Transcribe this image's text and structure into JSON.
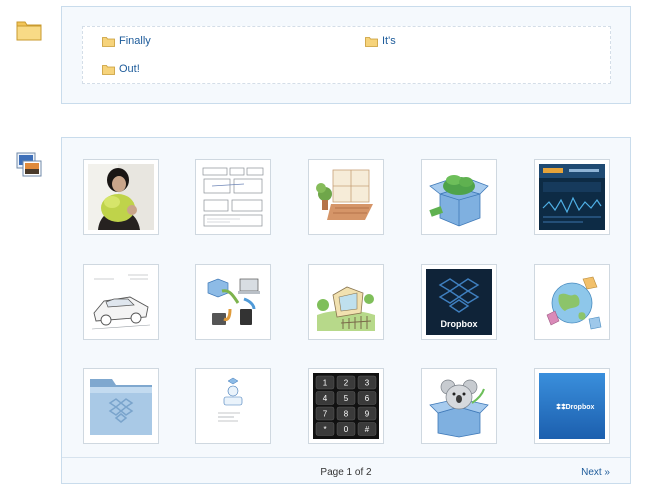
{
  "folders": {
    "items": [
      {
        "label": "Finally"
      },
      {
        "label": "It's"
      },
      {
        "label": "Out!"
      }
    ]
  },
  "photos": {
    "thumbnails": [
      {
        "name": "photo-person-green-toy",
        "icon": "photo-icon"
      },
      {
        "name": "photo-interface-sketch",
        "icon": "photo-icon"
      },
      {
        "name": "photo-window-plants",
        "icon": "photo-icon"
      },
      {
        "name": "photo-box-money",
        "icon": "photo-icon"
      },
      {
        "name": "photo-dark-website",
        "icon": "photo-icon"
      },
      {
        "name": "photo-car-sketch",
        "icon": "photo-icon"
      },
      {
        "name": "photo-boxes-devices",
        "icon": "photo-icon"
      },
      {
        "name": "photo-garden-fence",
        "icon": "photo-icon"
      },
      {
        "name": "photo-dropbox-dark",
        "icon": "photo-icon",
        "caption": "Dropbox"
      },
      {
        "name": "photo-globe-illustration",
        "icon": "photo-icon"
      },
      {
        "name": "photo-blue-folder",
        "icon": "photo-icon"
      },
      {
        "name": "photo-small-sketch",
        "icon": "photo-icon"
      },
      {
        "name": "photo-phone-keypad",
        "icon": "photo-icon"
      },
      {
        "name": "photo-koala-box",
        "icon": "photo-icon"
      },
      {
        "name": "photo-dropbox-blue",
        "icon": "photo-icon",
        "caption": "Dropbox"
      }
    ],
    "keypad_keys": [
      "1",
      "2",
      "3",
      "4",
      "5",
      "6",
      "7",
      "8",
      "9",
      "*",
      "0",
      "#"
    ]
  },
  "pagination": {
    "page_label": "Page 1 of 2",
    "next_label": "Next »"
  },
  "colors": {
    "panel_bg": "#f5f9fd",
    "panel_border": "#c9dcec",
    "link": "#1d5b9a",
    "folder_yellow": "#f6d37b",
    "dropbox_blue": "#2c78c8"
  }
}
